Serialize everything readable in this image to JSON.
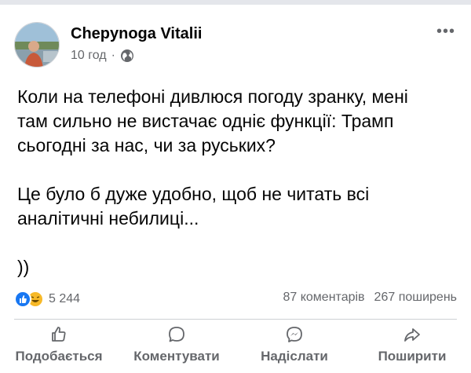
{
  "post": {
    "author": "Chepynoga Vitalii",
    "time": "10 год",
    "time_separator": "·",
    "privacy_icon": "globe-icon",
    "more_menu": "•••",
    "paragraphs": [
      "Коли на телефоні дивлюся погоду зранку, мені\nтам сильно не вистачає одніє функції: Трамп\nсьогодні за нас, чи за руських?",
      "Це було б дуже удобно, щоб не читать всі\nаналітичні небилиці...",
      "))"
    ]
  },
  "stats": {
    "reaction_icons": [
      "like-icon",
      "haha-icon"
    ],
    "reaction_count": "5 244",
    "comments": "87 коментарів",
    "shares": "267 поширень"
  },
  "actions": {
    "like": "Подобається",
    "comment": "Коментувати",
    "send": "Надіслати",
    "share": "Поширити"
  },
  "colors": {
    "text": "#050505",
    "secondary": "#65676b",
    "like_blue": "#1877f2",
    "haha_yellow": "#f7b928",
    "divider": "#ced0d4"
  }
}
